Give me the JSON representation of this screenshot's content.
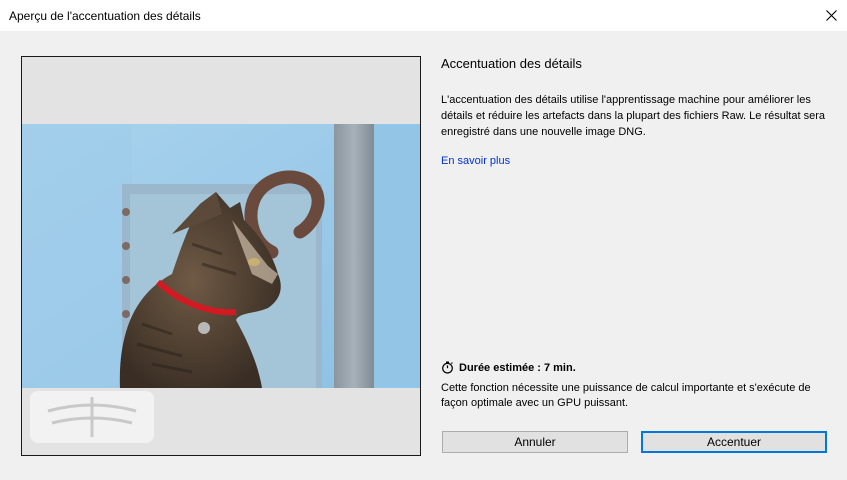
{
  "window": {
    "title": "Aperçu de l'accentuation des détails"
  },
  "icons": {
    "close": "close-icon",
    "timer": "stopwatch-icon",
    "watermark": "dragonfly-icon"
  },
  "preview": {
    "subject": "cat-photo"
  },
  "panel": {
    "heading": "Accentuation des détails",
    "description": "L'accentuation des détails utilise l'apprentissage machine pour améliorer les détails et réduire les artefacts dans la plupart des fichiers Raw. Le résultat sera enregistré dans une nouvelle image DNG.",
    "learn_more": "En savoir plus",
    "duration_label": "Durée estimée : 7 min.",
    "requirement": "Cette fonction nécessite une puissance de calcul importante et s'exécute de façon optimale avec un GPU puissant."
  },
  "buttons": {
    "cancel": "Annuler",
    "apply": "Accentuer"
  },
  "colors": {
    "link": "#0033cc",
    "focus_border": "#0078d7",
    "window_bg": "#f0f0f0"
  }
}
